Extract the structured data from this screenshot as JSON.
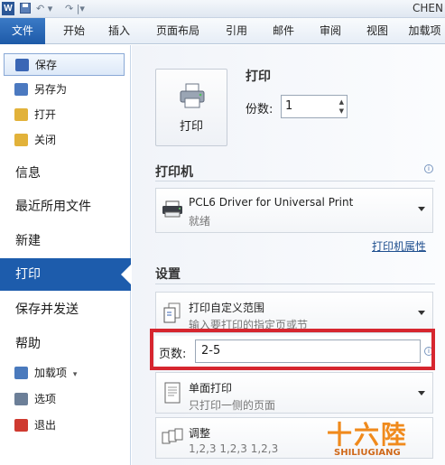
{
  "titlebar": {
    "app_letter": "W",
    "doc_title": "CHEN",
    "qa_save": "",
    "qa_undo": "↶ ▾",
    "qa_redo": "↷ |▾"
  },
  "tabs": [
    "文件",
    "开始",
    "插入",
    "页面布局",
    "引用",
    "邮件",
    "审阅",
    "视图",
    "加载项"
  ],
  "nav": {
    "small_top": [
      {
        "label": "保存",
        "icon": "save-icon",
        "color": "#3a66b5"
      },
      {
        "label": "另存为",
        "icon": "save-as-icon",
        "color": "#4b79c0"
      },
      {
        "label": "打开",
        "icon": "open-folder-icon",
        "color": "#e2b23a"
      },
      {
        "label": "关闭",
        "icon": "close-folder-icon",
        "color": "#e2b23a"
      }
    ],
    "large": [
      "信息",
      "最近所用文件",
      "新建",
      "打印",
      "保存并发送",
      "帮助"
    ],
    "small_bottom": [
      {
        "label": "加载项",
        "icon": "addins-icon",
        "color": "#4a7abd"
      },
      {
        "label": "选项",
        "icon": "options-icon",
        "color": "#6c7f98"
      },
      {
        "label": "退出",
        "icon": "exit-icon",
        "color": "#cf3a30"
      }
    ],
    "addins_caret": "▾"
  },
  "print": {
    "heading": "打印",
    "button_label": "打印",
    "copies_label": "份数:",
    "copies_value": "1"
  },
  "printer": {
    "heading": "打印机",
    "name": "PCL6 Driver for Universal Print",
    "status": "就绪",
    "properties_link": "打印机属性"
  },
  "settings": {
    "heading": "设置",
    "range_title": "打印自定义范围",
    "range_desc": "输入要打印的指定页或节",
    "pages_label": "页数:",
    "pages_value": "2-5",
    "sides_title": "单面打印",
    "sides_desc": "只打印一侧的页面",
    "collate_title": "调整",
    "collate_desc": "1,2,3    1,2,3    1,2,3"
  },
  "watermark": {
    "cn": "十六陸",
    "en": "SHILIUGIANG"
  },
  "colors": {
    "accent": "#1d5cac",
    "highlight": "#d6262f"
  }
}
